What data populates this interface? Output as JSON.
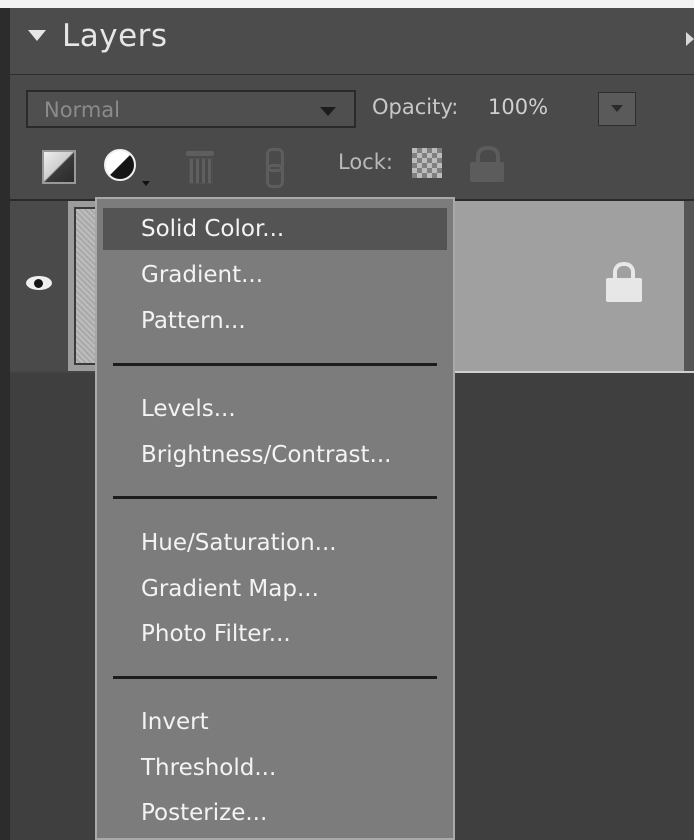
{
  "panel": {
    "title": "Layers"
  },
  "toolbar": {
    "blend_mode": "Normal",
    "opacity_label": "Opacity:",
    "opacity_value": "100%",
    "lock_label": "Lock:"
  },
  "menu": {
    "items": [
      {
        "label": "Solid Color...",
        "highlighted": true
      },
      {
        "label": "Gradient..."
      },
      {
        "label": "Pattern..."
      },
      {
        "label": "Levels..."
      },
      {
        "label": "Brightness/Contrast..."
      },
      {
        "label": "Hue/Saturation..."
      },
      {
        "label": "Gradient Map..."
      },
      {
        "label": "Photo Filter..."
      },
      {
        "label": "Invert"
      },
      {
        "label": "Threshold..."
      },
      {
        "label": "Posterize..."
      }
    ]
  },
  "icons": {
    "collapse": "chevron-down-icon",
    "new_layer": "new-layer-icon",
    "adjustment": "adjustment-layer-icon",
    "delete": "trash-icon",
    "link": "link-icon",
    "lock_transparency": "lock-transparent-pixels-icon",
    "lock_all": "lock-icon",
    "visibility": "eye-icon"
  }
}
